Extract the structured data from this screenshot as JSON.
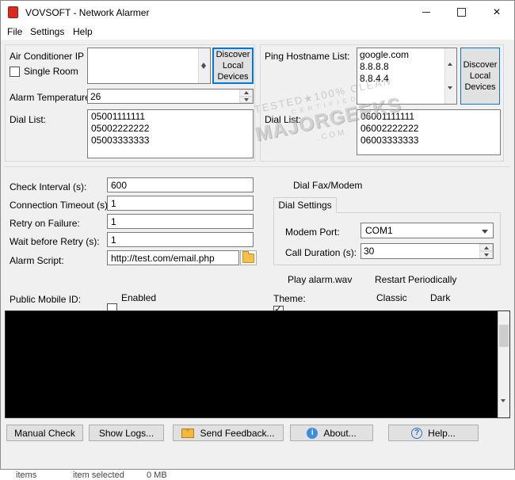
{
  "window": {
    "title": "VOVSOFT - Network Alarmer",
    "menu_items": [
      "File",
      "Settings",
      "Help"
    ]
  },
  "top_left": {
    "ip_list_label": "Air Conditioner IP List:",
    "ip_list_value": "",
    "discover_button_label": "Discover Local Devices",
    "single_room_label": "Single Room",
    "alarm_temp_label": "Alarm Temperature (°C):",
    "alarm_temp_value": "26",
    "dial_list_label": "Dial List:",
    "dial_list_value": "05001111111\n05002222222\n05003333333"
  },
  "top_right": {
    "ping_list_label": "Ping Hostname List:",
    "ping_list_value": "google.com\n8.8.8.8\n8.8.4.4",
    "discover_button_label": "Discover Local Devices",
    "dial_list_label": "Dial List:",
    "dial_list_value": "06001111111\n06002222222\n06003333333"
  },
  "settings_left": {
    "check_interval_label": "Check Interval (s):",
    "check_interval_value": "600",
    "connection_timeout_label": "Connection Timeout (s):",
    "connection_timeout_value": "1",
    "retry_on_failure_label": "Retry on Failure:",
    "retry_on_failure_value": "1",
    "wait_before_retry_label": "Wait before Retry (s):",
    "wait_before_retry_value": "1",
    "alarm_script_label": "Alarm Script:",
    "alarm_script_value": "http://test.com/email.php",
    "public_mobile_id_label": "Public Mobile ID:",
    "enabled_label": "Enabled"
  },
  "settings_right": {
    "dial_fax_modem_label": "Dial Fax/Modem",
    "dial_settings_tab": "Dial Settings",
    "modem_port_label": "Modem Port:",
    "modem_port_value": "COM1",
    "call_duration_label": "Call Duration (s):",
    "call_duration_value": "30",
    "play_alarm_label": "Play alarm.wav",
    "restart_label": "Restart Periodically",
    "theme_label": "Theme:",
    "theme_classic_label": "Classic",
    "theme_dark_label": "Dark"
  },
  "footer_buttons": {
    "manual_check": "Manual Check",
    "show_logs": "Show Logs...",
    "send_feedback": "Send Feedback...",
    "about": "About...",
    "help": "Help..."
  },
  "status_strip": {
    "items": "items",
    "selected": "item selected",
    "size": "0 MB"
  },
  "watermark": {
    "line1": "TESTED★100% CLEAN",
    "line2": "CERTIFIED",
    "line3": "MAJORGEEKS",
    "line4": ".COM"
  },
  "colors": {
    "accent": "#0078d7",
    "app_icon_red": "#d82c20"
  }
}
